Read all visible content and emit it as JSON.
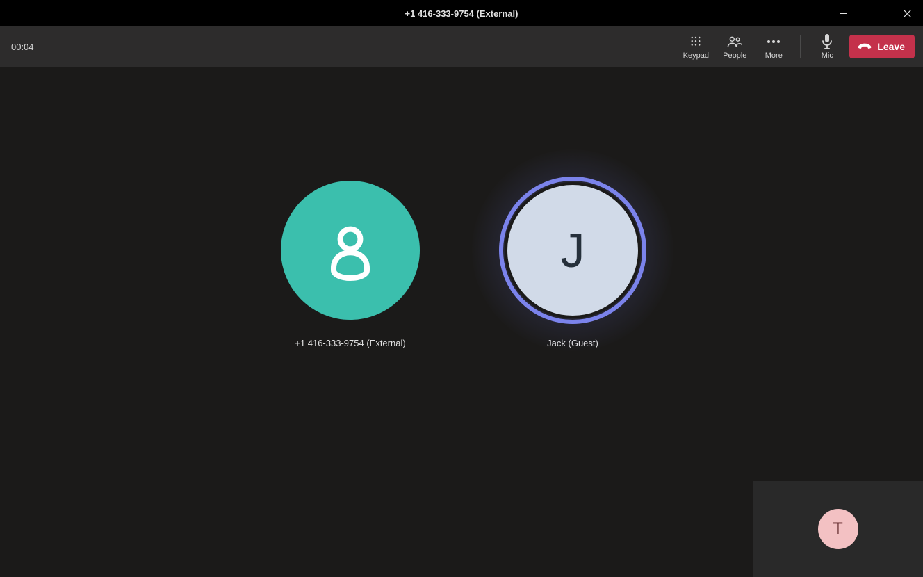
{
  "titlebar": {
    "title": "+1 416-333-9754 (External)"
  },
  "toolbar": {
    "timer": "00:04",
    "keypad_label": "Keypad",
    "people_label": "People",
    "more_label": "More",
    "mic_label": "Mic",
    "leave_label": "Leave"
  },
  "participants": [
    {
      "name": "+1 416-333-9754 (External)",
      "avatar_type": "icon",
      "color": "#3bbfad"
    },
    {
      "name": "Jack (Guest)",
      "avatar_type": "initial",
      "initial": "J",
      "color": "#d1dae8",
      "speaking": true
    }
  ],
  "selfview": {
    "initial": "T",
    "color": "#f3c1c3"
  }
}
